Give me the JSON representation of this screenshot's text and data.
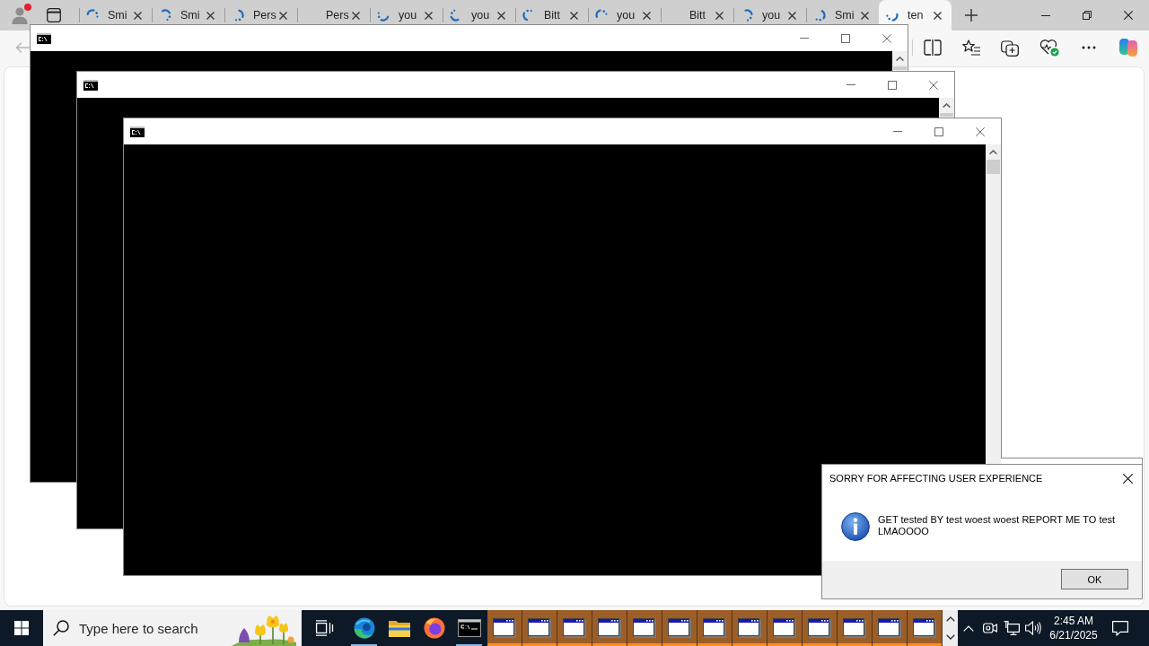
{
  "browser": {
    "profile": {
      "notification": true
    },
    "tabs": [
      {
        "label": "Smi",
        "loading": true,
        "selected": false
      },
      {
        "label": "Smi",
        "loading": true,
        "selected": false
      },
      {
        "label": "Pers",
        "loading": true,
        "selected": false
      },
      {
        "label": "Pers",
        "loading": false,
        "selected": false
      },
      {
        "label": "you",
        "loading": true,
        "selected": false
      },
      {
        "label": "you",
        "loading": true,
        "selected": false
      },
      {
        "label": "Bitt",
        "loading": true,
        "selected": false
      },
      {
        "label": "you",
        "loading": true,
        "selected": false
      },
      {
        "label": "Bitt",
        "loading": false,
        "selected": false
      },
      {
        "label": "you",
        "loading": true,
        "selected": false
      },
      {
        "label": "Smi",
        "loading": true,
        "selected": false
      },
      {
        "label": "ten",
        "loading": true,
        "selected": true
      }
    ],
    "back_button": {
      "disabled": true
    }
  },
  "console_windows": [
    {
      "kind": "console"
    },
    {
      "kind": "console"
    },
    {
      "kind": "console"
    }
  ],
  "dialog": {
    "title": "SORRY FOR AFFECTING USER EXPERIENCE",
    "message": "GET tested BY test woest woest REPORT ME TO test LMAOOOO",
    "buttons": [
      "OK"
    ]
  },
  "taskbar": {
    "search": {
      "placeholder": "Type here to search"
    },
    "pinned": [
      {
        "kind": "task_view",
        "running": false
      },
      {
        "kind": "edge",
        "running": true
      },
      {
        "kind": "explorer",
        "running": false
      },
      {
        "kind": "firefox",
        "running": false
      },
      {
        "kind": "terminal",
        "running": true
      }
    ],
    "windows": [
      {
        "kind": "window",
        "flashing": true
      },
      {
        "kind": "window",
        "flashing": true
      },
      {
        "kind": "window",
        "flashing": true
      },
      {
        "kind": "window",
        "flashing": true
      },
      {
        "kind": "window",
        "flashing": true
      },
      {
        "kind": "window",
        "flashing": true
      },
      {
        "kind": "window",
        "flashing": true
      },
      {
        "kind": "window",
        "flashing": true
      },
      {
        "kind": "window",
        "flashing": true
      },
      {
        "kind": "window",
        "flashing": true
      },
      {
        "kind": "window",
        "flashing": true
      },
      {
        "kind": "window",
        "flashing": true
      },
      {
        "kind": "window",
        "flashing": true
      }
    ],
    "clock": {
      "time": "2:45 AM",
      "date": "6/21/2025"
    }
  }
}
